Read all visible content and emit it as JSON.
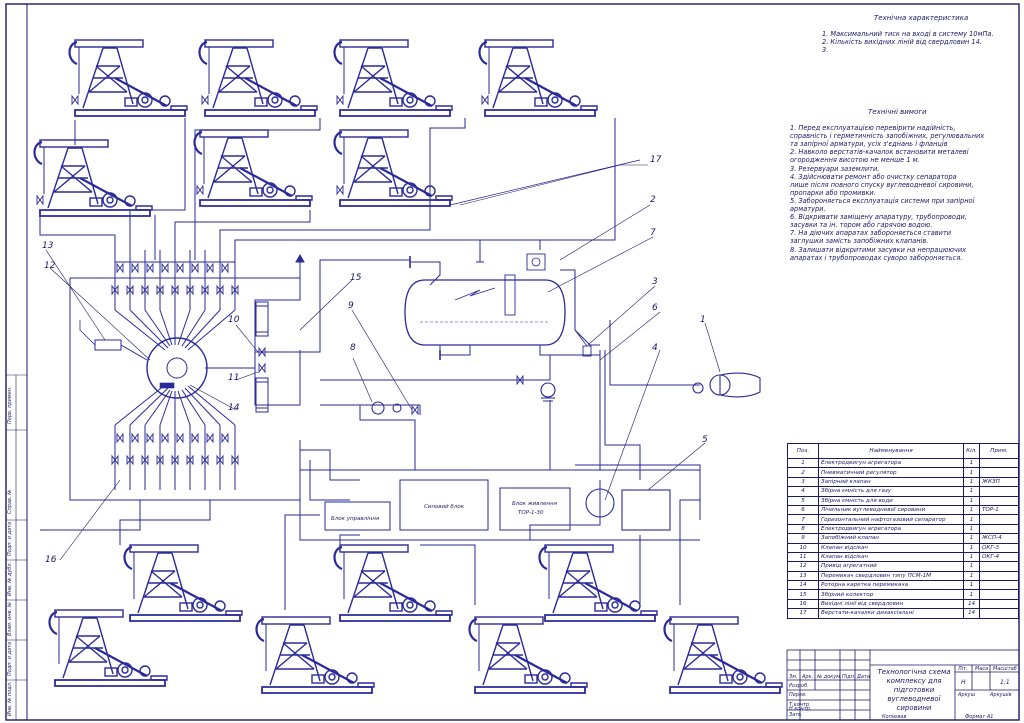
{
  "tech_characteristics": {
    "title": "Технічна характеристика",
    "lines": [
      "1. Максимальний тиск на вході в систему 10мПа.",
      "2. Кількість вихідних ліній від свердловин 14.",
      "3."
    ]
  },
  "tech_requirements": {
    "title": "Технічні вимоги",
    "lines": [
      "1. Перед експлуатацією перевірити надійність,",
      "  справність і герметичність запобіжних, регулювальних",
      "та запірної арматури, усіх з'єднань і фланців",
      "2. Навколо верстатів-качалок встановити металеві",
      "огородження висотою не менше 1 м.",
      "3. Резервуари заземлити.",
      "4. Здійснювати ремонт або очистку сепаратора",
      "лише після повного спуску вуглеводневої сировини,",
      "пропарки або промивки.",
      "5. Забороняється експлуатація системи при запірної",
      "арматури.",
      "6. Відкривати заміщену апаратуру, трубопроводи,",
      "засувки та ін. тором або гарячою водою.",
      "7. На діючих апаратах забороняється ставити",
      "заглушки замість запобіжних клапанів.",
      "8. Залишати відкритими засувки на непрацюючих",
      "апаратах і трубопроводах суворо забороняється."
    ]
  },
  "callouts": [
    "1",
    "2",
    "3",
    "4",
    "5",
    "6",
    "7",
    "8",
    "9",
    "10",
    "11",
    "12",
    "13",
    "14",
    "15",
    "16",
    "17"
  ],
  "blocks": {
    "control": "Блок управління",
    "power": "Силовий блок",
    "supply_line1": "Блок живлення",
    "supply_line2": "ТОР-1-30"
  },
  "spec_table": {
    "headers": [
      "Поз.",
      "Найменування",
      "Кіл.",
      "Прим."
    ],
    "rows": [
      {
        "pos": "1",
        "name": "Електродвигун агрегатора",
        "qty": "1",
        "note": ""
      },
      {
        "pos": "2",
        "name": "Пневматичний регулятор",
        "qty": "1",
        "note": ""
      },
      {
        "pos": "3",
        "name": "Запірний клапан",
        "qty": "1",
        "note": "ЖКЗП"
      },
      {
        "pos": "4",
        "name": "Збірна ємність для газу",
        "qty": "1",
        "note": ""
      },
      {
        "pos": "5",
        "name": "Збірна ємність для води",
        "qty": "1",
        "note": ""
      },
      {
        "pos": "6",
        "name": "Лічильник вуглеводневої сировини",
        "qty": "1",
        "note": "ТОР-1"
      },
      {
        "pos": "7",
        "name": "Горизонтальний нафтогазовий сепаратор",
        "qty": "1",
        "note": ""
      },
      {
        "pos": "8",
        "name": "Електродвигун агрегатора",
        "qty": "1",
        "note": ""
      },
      {
        "pos": "9",
        "name": "Запобіжний клапан",
        "qty": "1",
        "note": "ЖСП-4"
      },
      {
        "pos": "10",
        "name": "Клапан відсікач",
        "qty": "1",
        "note": "ОКГ-3"
      },
      {
        "pos": "11",
        "name": "Клапан відсікач",
        "qty": "1",
        "note": "ОКГ-4"
      },
      {
        "pos": "12",
        "name": "Привід агрегатний",
        "qty": "1",
        "note": ""
      },
      {
        "pos": "13",
        "name": "Перемикач свердловин типу ПСМ-1М",
        "qty": "1",
        "note": ""
      },
      {
        "pos": "14",
        "name": "Роторна каретка перемикача",
        "qty": "1",
        "note": ""
      },
      {
        "pos": "15",
        "name": "Збірний колектор",
        "qty": "1",
        "note": ""
      },
      {
        "pos": "16",
        "name": "Вихідні лінії від свердловин",
        "qty": "14",
        "note": ""
      },
      {
        "pos": "17",
        "name": "Верстати-качалки дизаксіальні",
        "qty": "14",
        "note": ""
      }
    ]
  },
  "title_block": {
    "title_line1": "Технологічна схема",
    "title_line2": "комплексу для підготовки",
    "title_line3": "вуглеводневої сировини",
    "lit": "Літ.",
    "mass": "Маса",
    "scale": "Масштаб",
    "scale_value": "1:1",
    "sheet": "Аркуш",
    "sheets": "Аркушів",
    "letter": "Н",
    "roles": [
      "Зм.",
      "Арк.",
      "№ докум.",
      "Підп.",
      "Дата",
      "Розроб.",
      "Перев.",
      "Т.контр.",
      "Н.контр.",
      "Затв."
    ],
    "copied": "Копіював",
    "format": "Формат А1"
  },
  "side_stamp": [
    "Перв. примен.",
    "Справ. №",
    "Подп. и дата",
    "Инв. № дубл.",
    "Взам. инв. №",
    "Подп. и дата",
    "Инв. № подл."
  ]
}
